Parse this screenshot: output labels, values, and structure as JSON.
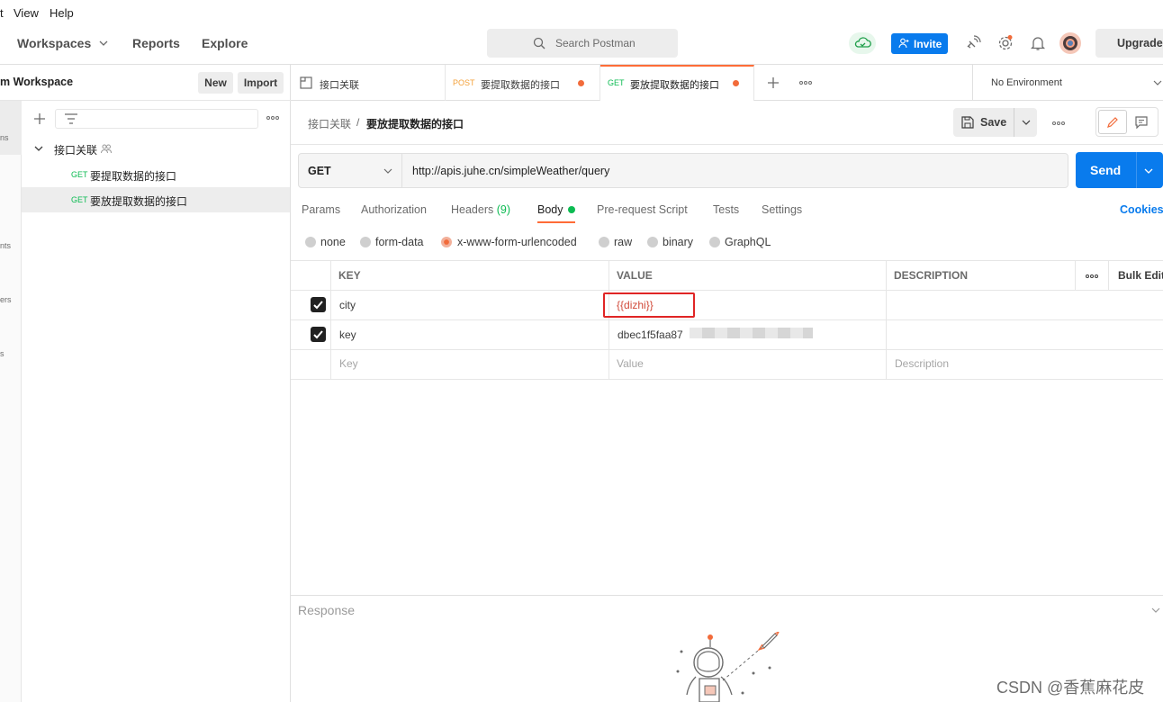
{
  "menubar": {
    "items": [
      "t",
      "View",
      "Help"
    ]
  },
  "header": {
    "nav": [
      "Workspaces",
      "Reports",
      "Explore"
    ],
    "search_placeholder": "Search Postman",
    "invite_label": "Invite",
    "upgrade_label": "Upgrade"
  },
  "sidebar": {
    "workspace_name": "m Workspace",
    "new_label": "New",
    "import_label": "Import",
    "rail_labels": [
      "ns",
      "nts",
      "ers",
      "s"
    ],
    "collection_name": "接口关联",
    "requests": [
      {
        "method": "GET",
        "name": "要提取数据的接口"
      },
      {
        "method": "GET",
        "name": "要放提取数据的接口"
      }
    ]
  },
  "tabs": [
    {
      "method": "",
      "name": "接口关联"
    },
    {
      "method": "POST",
      "name": "要提取数据的接口"
    },
    {
      "method": "GET",
      "name": "要放提取数据的接口"
    }
  ],
  "environment": "No Environment",
  "breadcrumb": {
    "parent": "接口关联",
    "sep": "/",
    "current": "要放提取数据的接口"
  },
  "save_label": "Save",
  "request": {
    "method": "GET",
    "url": "http://apis.juhe.cn/simpleWeather/query",
    "send_label": "Send"
  },
  "param_tabs": [
    {
      "label": "Params"
    },
    {
      "label": "Authorization"
    },
    {
      "label": "Headers",
      "count": "(9)"
    },
    {
      "label": "Body"
    },
    {
      "label": "Pre-request Script"
    },
    {
      "label": "Tests"
    },
    {
      "label": "Settings"
    }
  ],
  "cookies_label": "Cookies",
  "body_types": [
    "none",
    "form-data",
    "x-www-form-urlencoded",
    "raw",
    "binary",
    "GraphQL"
  ],
  "table": {
    "headers": [
      "KEY",
      "VALUE",
      "DESCRIPTION"
    ],
    "bulk_edit": "Bulk Edit",
    "rows": [
      {
        "key": "city",
        "value": "{{dizhi}}"
      },
      {
        "key": "key",
        "value": "dbec1f5faa87"
      }
    ],
    "placeholders": {
      "key": "Key",
      "value": "Value",
      "description": "Description"
    }
  },
  "response_label": "Response",
  "watermark": "CSDN @香蕉麻花皮",
  "colors": {
    "accent": "#ff6c37",
    "primary": "#097bed",
    "get": "#0cbb52",
    "post": "#f3a13b"
  }
}
